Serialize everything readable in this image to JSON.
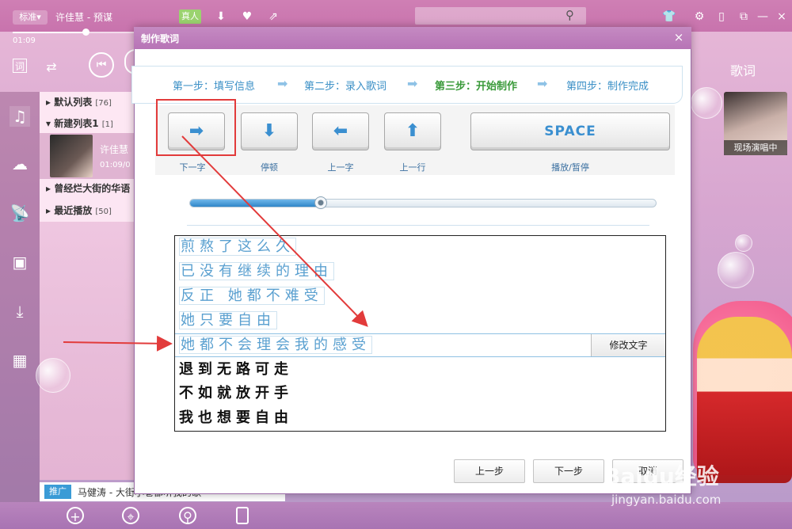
{
  "header": {
    "quality": "标准▾",
    "song": "许佳慧 - 预谋",
    "vip": "真人",
    "time": "01:09"
  },
  "sidebar": {
    "lists": [
      {
        "name": "默认列表",
        "count": "[76]"
      },
      {
        "name": "新建列表1",
        "count": "[1]"
      },
      {
        "name": "曾经烂大街的华语",
        "count": ""
      },
      {
        "name": "最近播放",
        "count": "[50]"
      }
    ],
    "current_artist": "许佳慧",
    "current_time": "01:09/0"
  },
  "promo": {
    "tag": "推广",
    "text": "马健涛 - 大街小巷都听我的歌"
  },
  "right": {
    "lyric_title": "歌词",
    "live_label": "现场演唱中"
  },
  "dialog": {
    "title": "制作歌词",
    "close": "×",
    "steps": [
      "第一步：填写信息",
      "第二步：录入歌词",
      "第三步：开始制作",
      "第四步：制作完成"
    ],
    "controls": [
      {
        "glyph": "➡",
        "label": "下一字"
      },
      {
        "glyph": "⬇",
        "label": "停顿"
      },
      {
        "glyph": "⬅",
        "label": "上一字"
      },
      {
        "glyph": "⬆",
        "label": "上一行"
      }
    ],
    "space_key": "SPACE",
    "space_label": "播放/暂停",
    "slider_progress": 0.28,
    "lyrics_done": [
      "煎熬了这么久",
      "已没有继续的理由",
      "反正 她都不难受",
      "她只要自由"
    ],
    "lyric_current": "她都不会理会我的感受",
    "lyrics_todo": [
      "退到无路可走",
      "不如就放开手",
      "我也想要自由"
    ],
    "edit_button": "修改文字",
    "prev_button": "上一步",
    "next_button": "下一步",
    "cancel_button": "取消"
  },
  "watermark": {
    "brand": "Baidu经验",
    "url": "jingyan.baidu.com"
  },
  "colors": {
    "accent": "#3a8fd0",
    "annotation": "#e23b3b",
    "current_step": "#3a9a3a"
  }
}
